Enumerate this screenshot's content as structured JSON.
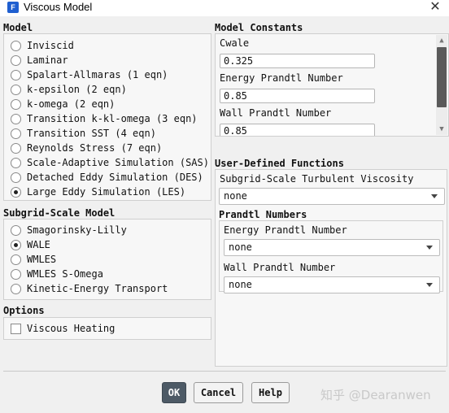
{
  "window": {
    "app_icon_letter": "F",
    "title": "Viscous Model",
    "close_glyph": "✕"
  },
  "model": {
    "title": "Model",
    "selected": "Large Eddy Simulation (LES)",
    "options": [
      "Inviscid",
      "Laminar",
      "Spalart-Allmaras (1 eqn)",
      "k-epsilon (2 eqn)",
      "k-omega (2 eqn)",
      "Transition k-kl-omega (3 eqn)",
      "Transition SST (4 eqn)",
      "Reynolds Stress (7 eqn)",
      "Scale-Adaptive Simulation (SAS)",
      "Detached Eddy Simulation (DES)",
      "Large Eddy Simulation (LES)"
    ]
  },
  "subgrid": {
    "title": "Subgrid-Scale Model",
    "selected": "WALE",
    "options": [
      "Smagorinsky-Lilly",
      "WALE",
      "WMLES",
      "WMLES S-Omega",
      "Kinetic-Energy Transport"
    ]
  },
  "options": {
    "title": "Options",
    "viscous_heating_label": "Viscous Heating",
    "viscous_heating_checked": false
  },
  "constants": {
    "title": "Model Constants",
    "fields": [
      {
        "label": "Cwale",
        "value": "0.325"
      },
      {
        "label": "Energy Prandtl Number",
        "value": "0.85"
      },
      {
        "label": "Wall Prandtl Number",
        "value": "0.85"
      }
    ]
  },
  "udf": {
    "title": "User-Defined Functions",
    "subgrid_label": "Subgrid-Scale Turbulent Viscosity",
    "subgrid_value": "none",
    "prandtl_title": "Prandtl Numbers",
    "energy_label": "Energy Prandtl Number",
    "energy_value": "none",
    "wall_label": "Wall Prandtl Number",
    "wall_value": "none"
  },
  "buttons": {
    "ok": "OK",
    "cancel": "Cancel",
    "help": "Help"
  },
  "watermark": "知乎 @Dearanwen",
  "colors": {
    "primary_button": "#4d5a66",
    "app_icon": "#1f5fd0",
    "scroll_thumb": "#5a5a5a"
  }
}
